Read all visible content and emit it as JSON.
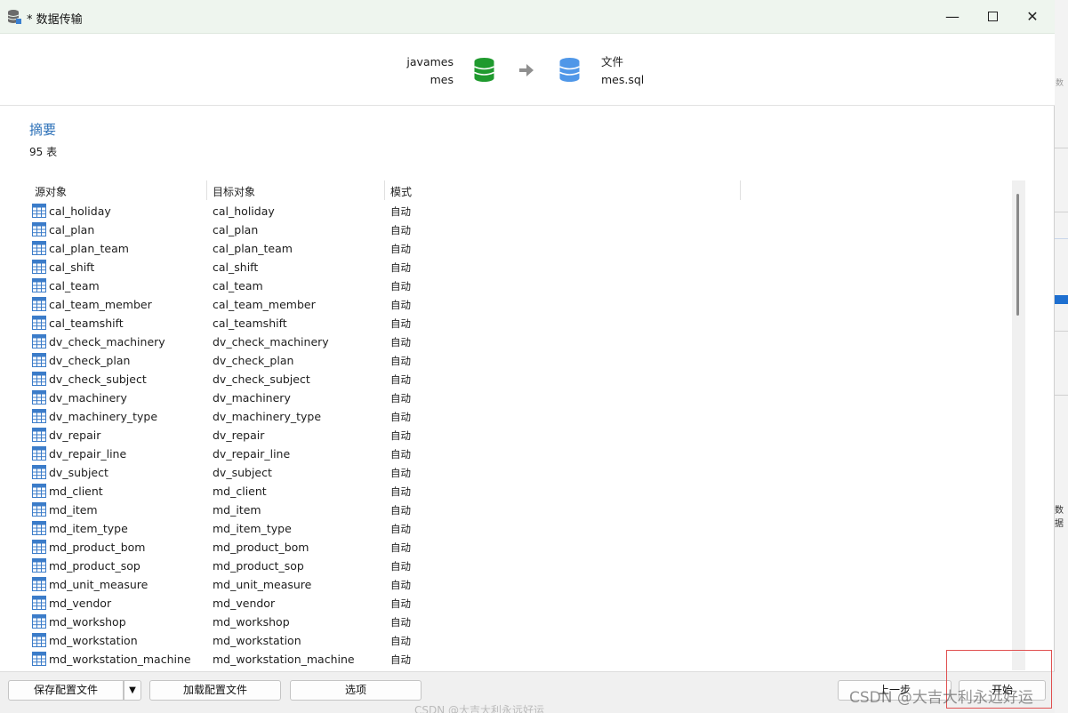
{
  "window": {
    "title": "* 数据传输",
    "controls": {
      "minimize": "—",
      "close": "✕"
    }
  },
  "transfer": {
    "source": {
      "connection": "javames",
      "database": "mes",
      "icon": "database-green-icon",
      "color": "#1f9a2e"
    },
    "arrow_icon": "arrow-right-icon",
    "target": {
      "type": "文件",
      "file": "mes.sql",
      "icon": "database-blue-icon",
      "color": "#4f97e8"
    }
  },
  "summary": {
    "title": "摘要",
    "count": "95 表"
  },
  "table": {
    "headers": {
      "source": "源对象",
      "target": "目标对象",
      "mode": "模式"
    },
    "rows": [
      {
        "source": "cal_holiday",
        "target": "cal_holiday",
        "mode": "自动"
      },
      {
        "source": "cal_plan",
        "target": "cal_plan",
        "mode": "自动"
      },
      {
        "source": "cal_plan_team",
        "target": "cal_plan_team",
        "mode": "自动"
      },
      {
        "source": "cal_shift",
        "target": "cal_shift",
        "mode": "自动"
      },
      {
        "source": "cal_team",
        "target": "cal_team",
        "mode": "自动"
      },
      {
        "source": "cal_team_member",
        "target": "cal_team_member",
        "mode": "自动"
      },
      {
        "source": "cal_teamshift",
        "target": "cal_teamshift",
        "mode": "自动"
      },
      {
        "source": "dv_check_machinery",
        "target": "dv_check_machinery",
        "mode": "自动"
      },
      {
        "source": "dv_check_plan",
        "target": "dv_check_plan",
        "mode": "自动"
      },
      {
        "source": "dv_check_subject",
        "target": "dv_check_subject",
        "mode": "自动"
      },
      {
        "source": "dv_machinery",
        "target": "dv_machinery",
        "mode": "自动"
      },
      {
        "source": "dv_machinery_type",
        "target": "dv_machinery_type",
        "mode": "自动"
      },
      {
        "source": "dv_repair",
        "target": "dv_repair",
        "mode": "自动"
      },
      {
        "source": "dv_repair_line",
        "target": "dv_repair_line",
        "mode": "自动"
      },
      {
        "source": "dv_subject",
        "target": "dv_subject",
        "mode": "自动"
      },
      {
        "source": "md_client",
        "target": "md_client",
        "mode": "自动"
      },
      {
        "source": "md_item",
        "target": "md_item",
        "mode": "自动"
      },
      {
        "source": "md_item_type",
        "target": "md_item_type",
        "mode": "自动"
      },
      {
        "source": "md_product_bom",
        "target": "md_product_bom",
        "mode": "自动"
      },
      {
        "source": "md_product_sop",
        "target": "md_product_sop",
        "mode": "自动"
      },
      {
        "source": "md_unit_measure",
        "target": "md_unit_measure",
        "mode": "自动"
      },
      {
        "source": "md_vendor",
        "target": "md_vendor",
        "mode": "自动"
      },
      {
        "source": "md_workshop",
        "target": "md_workshop",
        "mode": "自动"
      },
      {
        "source": "md_workstation",
        "target": "md_workstation",
        "mode": "自动"
      },
      {
        "source": "md_workstation_machine",
        "target": "md_workstation_machine",
        "mode": "自动"
      }
    ]
  },
  "footer": {
    "save_config": "保存配置文件",
    "save_dropdown": "▼",
    "load_config": "加载配置文件",
    "options": "选项",
    "previous": "上一步",
    "start": "开始"
  },
  "watermark": "CSDN @大吉大利永远好运",
  "watermark_faint": "CSDN @大吉大利永远好运",
  "background_app": {
    "label": "数据",
    "faint_label": "数"
  }
}
